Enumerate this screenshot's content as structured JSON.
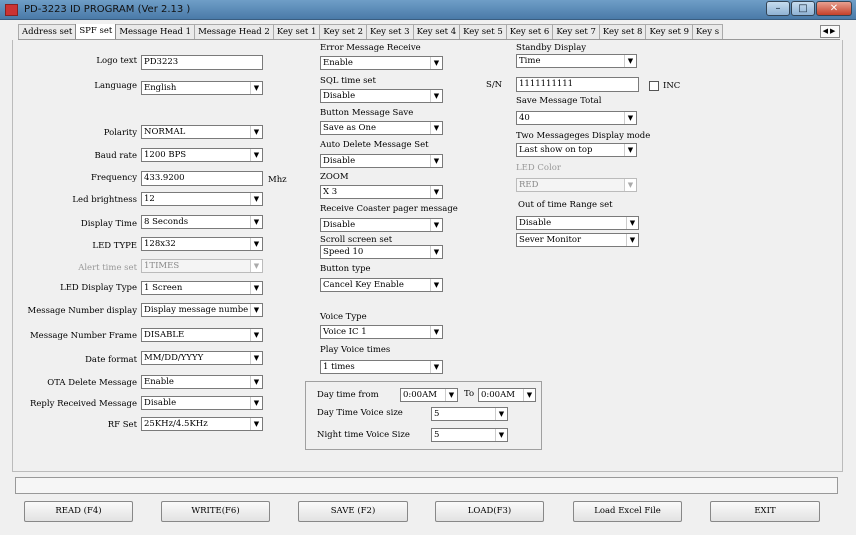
{
  "window": {
    "title": "PD-3223 ID PROGRAM (Ver 2.13 )",
    "min": "–",
    "max": "□",
    "close": "✕"
  },
  "tabs": [
    "Address set",
    "SPF set",
    "Message Head 1",
    "Message Head 2",
    "Key set 1",
    "Key set 2",
    "Key set 3",
    "Key set 4",
    "Key set 5",
    "Key set 6",
    "Key set 7",
    "Key set 8",
    "Key set 9",
    "Key s"
  ],
  "active_tab": "SPF set",
  "tab_scroll_arrows": "◀▶",
  "dropdown_arrow": "▼",
  "left": {
    "logo_text_label": "Logo text",
    "logo_text_value": "PD3223",
    "language_label": "Language",
    "language_value": "English",
    "polarity_label": "Polarity",
    "polarity_value": "NORMAL",
    "baud_label": "Baud rate",
    "baud_value": "1200 BPS",
    "freq_label": "Frequency",
    "freq_value": "433.9200",
    "freq_unit": "Mhz",
    "led_brightness_label": "Led brightness",
    "led_brightness_value": "12",
    "display_time_label": "Display Time",
    "display_time_value": "8  Seconds",
    "led_type_label": "LED TYPE",
    "led_type_value": "128x32",
    "alert_time_label": "Alert time set",
    "alert_time_value": "1TIMES",
    "led_display_type_label": "LED Display Type",
    "led_display_type_value": "1 Screen",
    "msg_number_display_label": "Message Number display",
    "msg_number_display_value": "Display message numbe",
    "msg_number_frame_label": "Message Number Frame",
    "msg_number_frame_value": "DISABLE",
    "date_format_label": "Date format",
    "date_format_value": "MM/DD/YYYY",
    "ota_delete_label": "OTA Delete Message",
    "ota_delete_value": "Enable",
    "reply_received_label": "Reply Received Message",
    "reply_received_value": "Disable",
    "rf_set_label": "RF Set",
    "rf_set_value": "25KHz/4.5KHz"
  },
  "middle": {
    "error_msg_label": "Error Message Receive",
    "error_msg_value": "Enable",
    "sql_time_label": "SQL time  set",
    "sql_time_value": "Disable",
    "button_msg_save_label": "Button Message Save",
    "button_msg_save_value": "Save as One",
    "auto_delete_label": "Auto Delete Message Set",
    "auto_delete_value": "Disable",
    "zoom_label": "ZOOM",
    "zoom_value": "X 3",
    "coaster_pager_label": "Receive Coaster pager message",
    "coaster_pager_value": "Disable",
    "scroll_label": "Scroll screen set",
    "scroll_value": "Speed 10",
    "button_type_label": "Button type",
    "button_type_value": "Cancel Key Enable",
    "voice_type_label": "Voice Type",
    "voice_type_value": "Voice IC 1",
    "play_voice_label": "Play Voice times",
    "play_voice_value": "1 times"
  },
  "daytime": {
    "from_label": "Day time from",
    "from_value": "0:00AM",
    "to_label": "To",
    "to_value": "0:00AM",
    "day_voice_label": "Day Time Voice size",
    "day_voice_value": "5",
    "night_voice_label": "Night time Voice Size",
    "night_voice_value": "5"
  },
  "right": {
    "standby_label": "Standby Display",
    "standby_value": "Time",
    "sn_label": "S/N",
    "sn_value": "1111111111",
    "inc_label": "INC",
    "save_total_label": "Save Message Total",
    "save_total_value": "40",
    "two_msg_label": "Two Messageges Display mode",
    "two_msg_value": "Last show on top",
    "led_color_label": "LED Color",
    "led_color_value": "RED",
    "out_of_range_label": "Out of time Range set",
    "out_of_range_value1": "Disable",
    "out_of_range_value2": "Sever Monitor"
  },
  "buttons": {
    "read": "READ (F4)",
    "write": "WRITE(F6)",
    "save": "SAVE  (F2)",
    "load": "LOAD(F3)",
    "excel": "Load Excel File",
    "exit": "EXIT"
  }
}
